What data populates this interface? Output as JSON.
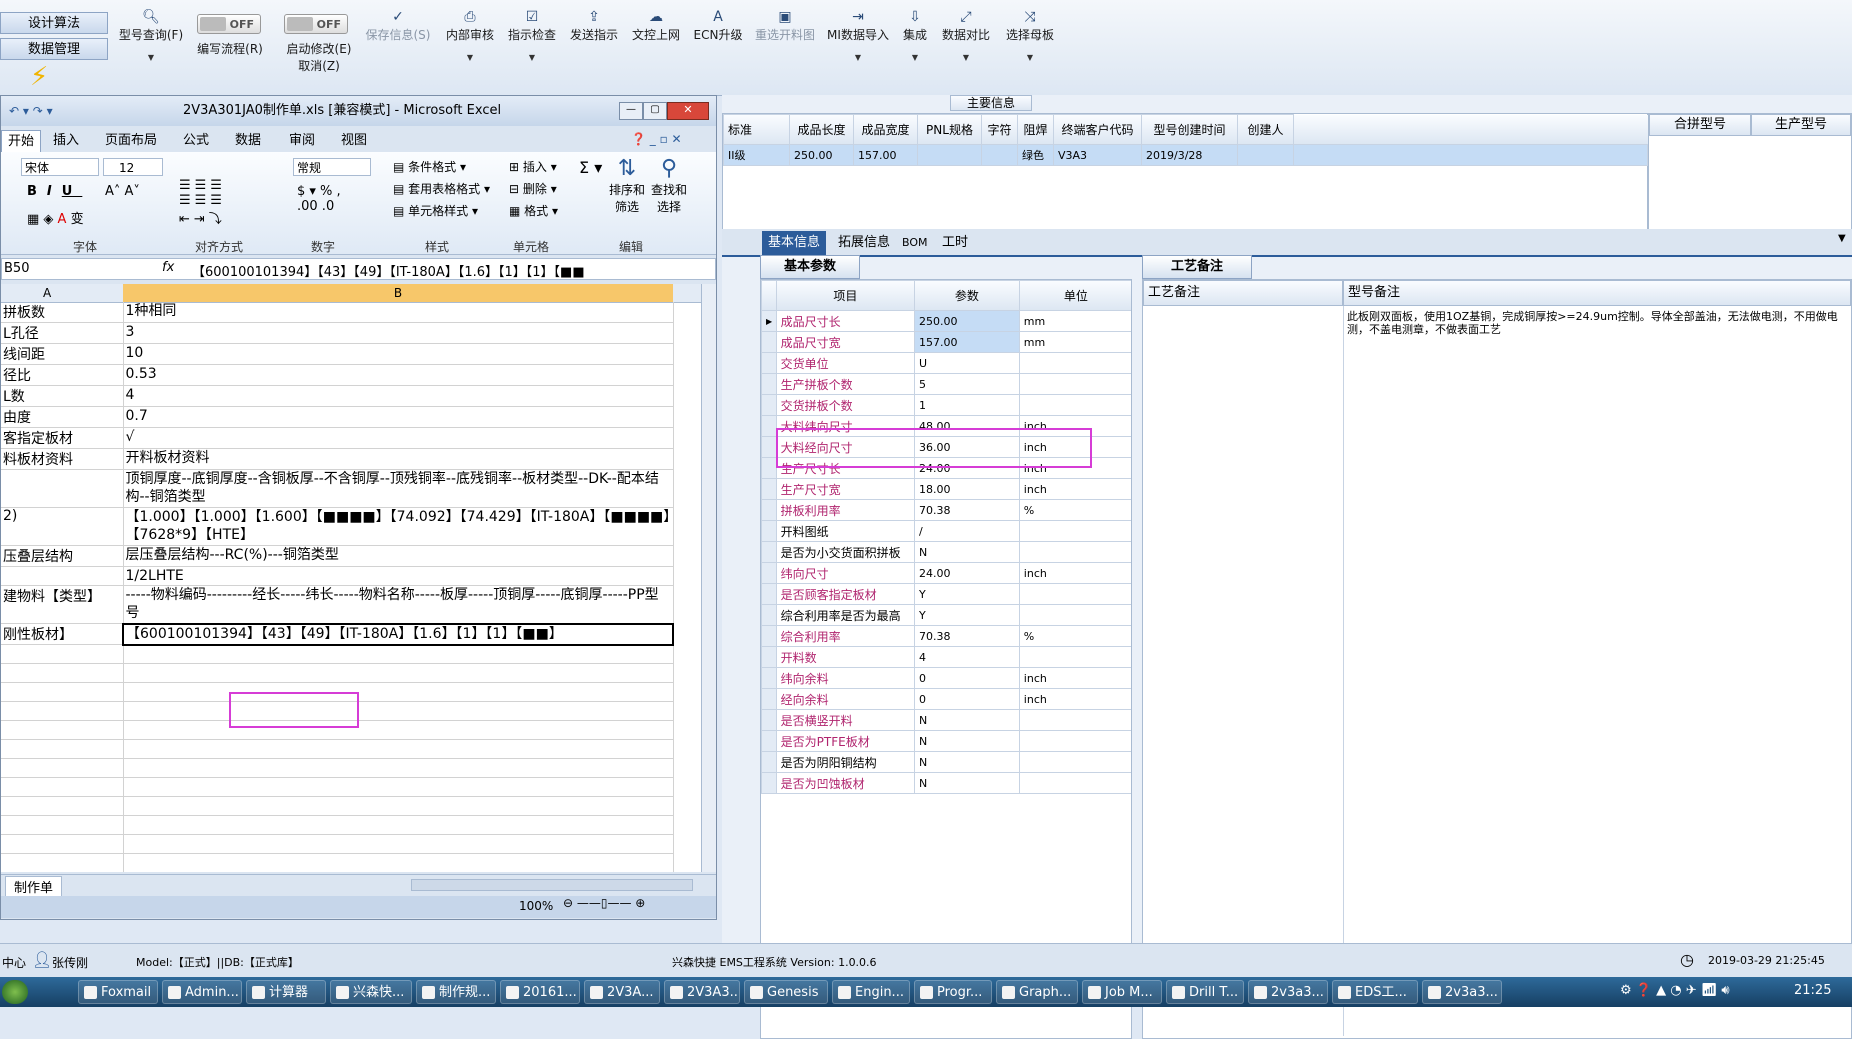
{
  "left_panel": {
    "btn1": "设计算法",
    "btn2": "数据管理"
  },
  "toolbar": {
    "model_query": "型号查询(F)",
    "write_flow": "编写流程(R)",
    "enable_edit": "启动修改(E)",
    "cancel": "取消(Z)",
    "save_info": "保存信息(S)",
    "internal_review": "内部审核",
    "guide_check": "指示检查",
    "send_guide": "发送指示",
    "doc_upload": "文控上网",
    "ecn": "ECN升级",
    "reselect": "重选开料图",
    "mi_import": "MI数据导入",
    "integrate": "集成",
    "compare": "数据对比",
    "choose_master": "选择母板",
    "toggle_off": "OFF"
  },
  "main_info": {
    "title": "主要信息",
    "headers": [
      "标准",
      "成品长度",
      "成品宽度",
      "PNL规格",
      "字符",
      "阻焊",
      "终端客户代码",
      "型号创建时间",
      "创建人"
    ],
    "row": [
      "II级",
      "250.00",
      "157.00",
      "",
      "绿色",
      "V3A3",
      "2019/3/28",
      ""
    ],
    "extra_headers": [
      "合拼型号",
      "生产型号"
    ]
  },
  "tabs": {
    "basic": "基本信息",
    "extended": "拓展信息",
    "bom": "BOM",
    "hours": "工时",
    "sub_basic": "基本参数",
    "process_note": "工艺备注"
  },
  "params": {
    "headers": [
      "项目",
      "参数",
      "单位"
    ],
    "rows": [
      {
        "item": "成品尺寸长",
        "value": "250.00",
        "unit": "mm"
      },
      {
        "item": "成品尺寸宽",
        "value": "157.00",
        "unit": "mm"
      },
      {
        "item": "交货单位",
        "value": "U",
        "unit": ""
      },
      {
        "item": "生产拼板个数",
        "value": "5",
        "unit": ""
      },
      {
        "item": "交货拼板个数",
        "value": "1",
        "unit": ""
      },
      {
        "item": "大料纬向尺寸",
        "value": "48.00",
        "unit": "inch"
      },
      {
        "item": "大料经向尺寸",
        "value": "36.00",
        "unit": "inch"
      },
      {
        "item": "生产尺寸长",
        "value": "24.00",
        "unit": "inch"
      },
      {
        "item": "生产尺寸宽",
        "value": "18.00",
        "unit": "inch"
      },
      {
        "item": "拼板利用率",
        "value": "70.38",
        "unit": "%"
      },
      {
        "item": "开料图纸",
        "value": "/",
        "unit": ""
      },
      {
        "item": "是否为小交货面积拼板",
        "value": "N",
        "unit": ""
      },
      {
        "item": "纬向尺寸",
        "value": "24.00",
        "unit": "inch"
      },
      {
        "item": "是否顾客指定板材",
        "value": "Y",
        "unit": ""
      },
      {
        "item": "综合利用率是否为最高",
        "value": "Y",
        "unit": ""
      },
      {
        "item": "综合利用率",
        "value": "70.38",
        "unit": "%"
      },
      {
        "item": "开料数",
        "value": "4",
        "unit": ""
      },
      {
        "item": "纬向余料",
        "value": "0",
        "unit": "inch"
      },
      {
        "item": "经向余料",
        "value": "0",
        "unit": "inch"
      },
      {
        "item": "是否横竖开料",
        "value": "N",
        "unit": ""
      },
      {
        "item": "是否为PTFE板材",
        "value": "N",
        "unit": ""
      },
      {
        "item": "是否为阴阳铜结构",
        "value": "N",
        "unit": ""
      },
      {
        "item": "是否为凹蚀板材",
        "value": "N",
        "unit": ""
      }
    ]
  },
  "process": {
    "col1": "工艺备注",
    "col2": "型号备注",
    "note": "此板刚双面板，使用1OZ基铜，完成铜厚按>=24.9um控制。导体全部盖油，无法做电测，不用做电测，不盖电测章，不做表面工艺"
  },
  "excel": {
    "title": "2V3A301JA0制作单.xls [兼容模式] - Microsoft Excel",
    "tabs": [
      "开始",
      "插入",
      "页面布局",
      "公式",
      "数据",
      "审阅",
      "视图"
    ],
    "font": "宋体",
    "size": "12",
    "format": "常规",
    "btn_cond": "条件格式",
    "btn_table": "套用表格格式",
    "btn_cell": "单元格样式",
    "btn_insert": "插入",
    "btn_delete": "删除",
    "btn_format": "格式",
    "btn_sort": "排序和筛选",
    "btn_find": "查找和选择",
    "groups": [
      "字体",
      "对齐方式",
      "数字",
      "样式",
      "单元格",
      "编辑"
    ],
    "cellref": "B50",
    "formula": "【600100101394】【43】【49】【IT-180A】【1.6】【1】【1】【■■",
    "cols": [
      "A",
      "B"
    ],
    "rows": [
      {
        "a": "拼板数",
        "b": "1种相同"
      },
      {
        "a": "L孔径",
        "b": "3"
      },
      {
        "a": "线间距",
        "b": "10"
      },
      {
        "a": "径比",
        "b": "0.53"
      },
      {
        "a": "L数",
        "b": "4"
      },
      {
        "a": "由度",
        "b": "0.7"
      },
      {
        "a": "客指定板材",
        "b": "√"
      },
      {
        "a": "料板材资料",
        "b": "开料板材资料"
      },
      {
        "a": "",
        "b": "顶铜厚度--底铜厚度--含铜板厚--不含铜厚--顶残铜率--底残铜率--板材类型--DK--配本结构--铜箔类型"
      },
      {
        "a": "2)",
        "b": "【1.000】【1.000】【1.600】【■■■■】【74.092】【74.429】【IT-180A】【■■■■】【7628*9】【HTE】"
      },
      {
        "a": "压叠层结构",
        "b": "层压叠层结构---RC(%)---铜箔类型"
      },
      {
        "a": "",
        "b": "1/2LHTE"
      },
      {
        "a": "建物料【类型】",
        "b": "-----物料编码---------经长-----纬长-----物料名称-----板厚-----顶铜厚-----底铜厚-----PP型号"
      },
      {
        "a": "刚性板材】",
        "b": "【600100101394】【43】【49】【IT-180A】【1.6】【1】【1】【■■】"
      }
    ],
    "sheet": "制作单",
    "zoom": "100%"
  },
  "status": {
    "left": "中心",
    "user": "张传刚",
    "model": "Model:【正式】||DB:【正式库】",
    "system": "兴森快捷 EMS工程系统 Version: 1.0.0.6",
    "datetime": "2019-03-29 21:25:45"
  },
  "taskbar": {
    "items": [
      "Foxmail",
      "Admin...",
      "计算器",
      "兴森快...",
      "制作规...",
      "20161...",
      "2V3A...",
      "2V3A3...",
      "Genesis",
      "Engin...",
      "Progr...",
      "Graph...",
      "Job M...",
      "Drill T...",
      "2v3a3...",
      "EDS工...",
      "2v3a3..."
    ],
    "clock": "21:25"
  }
}
